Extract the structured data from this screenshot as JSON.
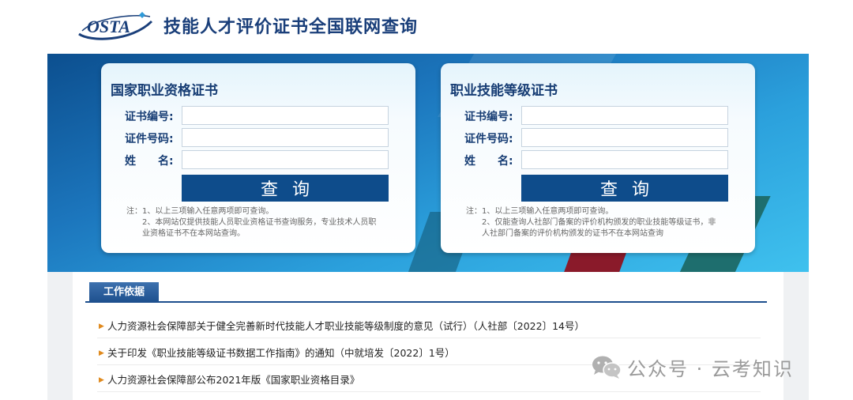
{
  "header": {
    "logo_text": "OSTA",
    "site_title": "技能人才评价证书全国联网查询"
  },
  "cards": [
    {
      "title": "国家职业资格证书",
      "fields": [
        {
          "label": "证书编号:",
          "value": "",
          "placeholder": ""
        },
        {
          "label": "证件号码:",
          "value": "",
          "placeholder": ""
        },
        {
          "label": "姓　　名:",
          "value": "",
          "placeholder": ""
        }
      ],
      "button_label": "查询",
      "notes": [
        "注：1、以上三项输入任意两项即可查询。",
        "2、本网站仅提供技能人员职业资格证书查询服务，专业技术人员职",
        "业资格证书不在本网站查询。"
      ]
    },
    {
      "title": "职业技能等级证书",
      "fields": [
        {
          "label": "证书编号:",
          "value": "",
          "placeholder": ""
        },
        {
          "label": "证件号码:",
          "value": "",
          "placeholder": ""
        },
        {
          "label": "姓　　名:",
          "value": "",
          "placeholder": ""
        }
      ],
      "button_label": "查询",
      "notes": [
        "注：1、以上三项输入任意两项即可查询。",
        "2、仅能查询人社部门备案的评价机构颁发的职业技能等级证书，非",
        "人社部门备案的评价机构颁发的证书不在本网站查询"
      ]
    }
  ],
  "section": {
    "tab_label": "工作依据",
    "items": [
      "人力资源社会保障部关于健全完善新时代技能人才职业技能等级制度的意见（试行）（人社部〔2022〕14号）",
      "关于印发《职业技能等级证书数据工作指南》的通知（中就培发〔2022〕1号）",
      "人力资源社会保障部公布2021年版《国家职业资格目录》"
    ]
  },
  "watermark": {
    "text": "公众号 · 云考知识",
    "icon": "wechat-icon"
  },
  "colors": {
    "brand_blue": "#0e4c8b",
    "title_blue": "#173d74",
    "bullet_orange": "#e08a1e"
  }
}
